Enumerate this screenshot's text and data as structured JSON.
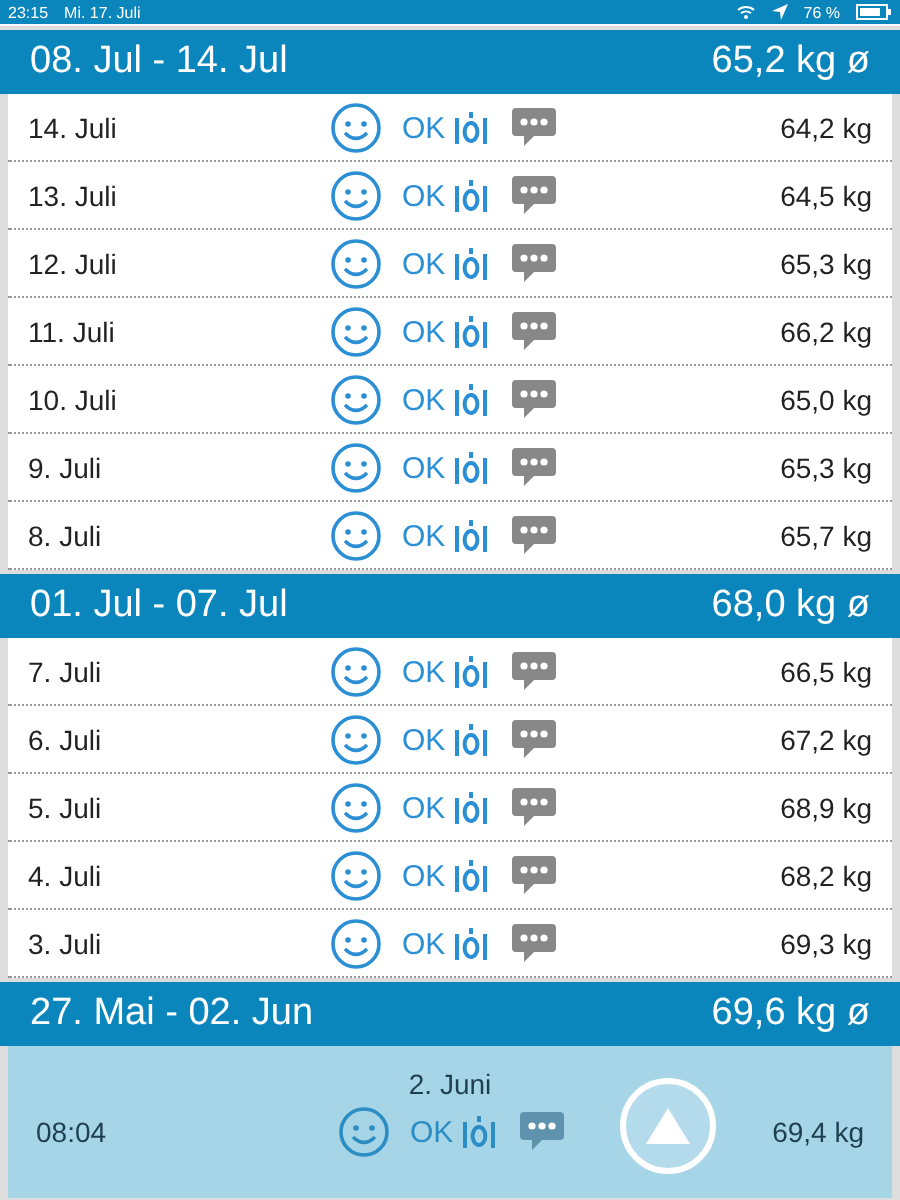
{
  "status_bar": {
    "time": "23:15",
    "date": "Mi. 17. Juli",
    "battery": "76 %"
  },
  "weeks": [
    {
      "range": "08. Jul - 14. Jul",
      "average": "65,2 kg ø",
      "days": [
        {
          "date": "14. Juli",
          "status": "OK",
          "weight": "64,2 kg"
        },
        {
          "date": "13. Juli",
          "status": "OK",
          "weight": "64,5 kg"
        },
        {
          "date": "12. Juli",
          "status": "OK",
          "weight": "65,3 kg"
        },
        {
          "date": "11. Juli",
          "status": "OK",
          "weight": "66,2 kg"
        },
        {
          "date": "10. Juli",
          "status": "OK",
          "weight": "65,0 kg"
        },
        {
          "date": "9. Juli",
          "status": "OK",
          "weight": "65,3 kg"
        },
        {
          "date": "8. Juli",
          "status": "OK",
          "weight": "65,7 kg"
        }
      ]
    },
    {
      "range": "01. Jul - 07. Jul",
      "average": "68,0 kg ø",
      "days": [
        {
          "date": "7. Juli",
          "status": "OK",
          "weight": "66,5 kg"
        },
        {
          "date": "6. Juli",
          "status": "OK",
          "weight": "67,2 kg"
        },
        {
          "date": "5. Juli",
          "status": "OK",
          "weight": "68,9 kg"
        },
        {
          "date": "4. Juli",
          "status": "OK",
          "weight": "68,2 kg"
        },
        {
          "date": "3. Juli",
          "status": "OK",
          "weight": "69,3 kg"
        }
      ]
    },
    {
      "range": "27. Mai - 02. Jun",
      "average": "69,6 kg ø",
      "expanded": true,
      "detail": {
        "day": "2. Juni",
        "entries": [
          {
            "time": "08:04",
            "status": "OK",
            "weight": "69,4 kg"
          }
        ]
      }
    }
  ]
}
